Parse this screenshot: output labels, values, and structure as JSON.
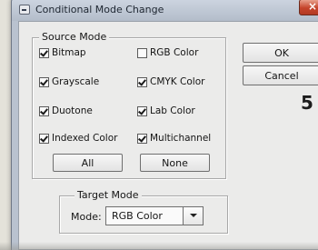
{
  "window": {
    "title": "Conditional Mode Change",
    "close_symbol": "×"
  },
  "source_mode": {
    "label": "Source Mode",
    "options": [
      {
        "label": "Bitmap",
        "checked": true
      },
      {
        "label": "RGB Color",
        "checked": false
      },
      {
        "label": "Grayscale",
        "checked": true
      },
      {
        "label": "CMYK Color",
        "checked": true
      },
      {
        "label": "Duotone",
        "checked": true
      },
      {
        "label": "Lab Color",
        "checked": true
      },
      {
        "label": "Indexed Color",
        "checked": true
      },
      {
        "label": "Multichannel",
        "checked": true
      }
    ],
    "all_label": "All",
    "none_label": "None"
  },
  "buttons": {
    "ok_label": "OK",
    "cancel_label": "Cancel"
  },
  "annotation_number": "5",
  "target_mode": {
    "label": "Target Mode",
    "mode_label": "Mode:",
    "selected": "RGB Color"
  }
}
